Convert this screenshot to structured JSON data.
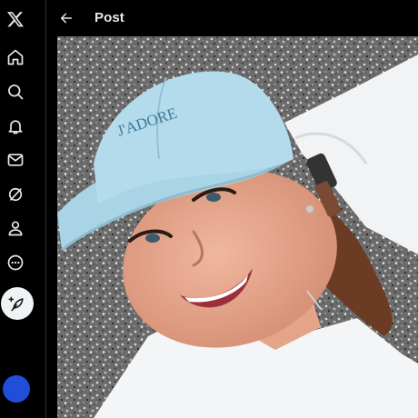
{
  "header": {
    "title": "Post"
  },
  "sidebar": {
    "items": [
      {
        "icon": "x-logo-icon"
      },
      {
        "icon": "home-icon"
      },
      {
        "icon": "search-icon"
      },
      {
        "icon": "notifications-bell-icon"
      },
      {
        "icon": "messages-envelope-icon"
      },
      {
        "icon": "grok-icon"
      },
      {
        "icon": "profile-person-icon"
      },
      {
        "icon": "more-circle-icon"
      }
    ],
    "compose_icon": "compose-feather-icon",
    "avatar_color": "#1f4ed8"
  },
  "photo": {
    "cap_text": "J'ADORE"
  },
  "colors": {
    "background": "#000000",
    "text": "#e7e9ea",
    "divider": "#2f3336",
    "compose_button": "#eff3f4"
  }
}
